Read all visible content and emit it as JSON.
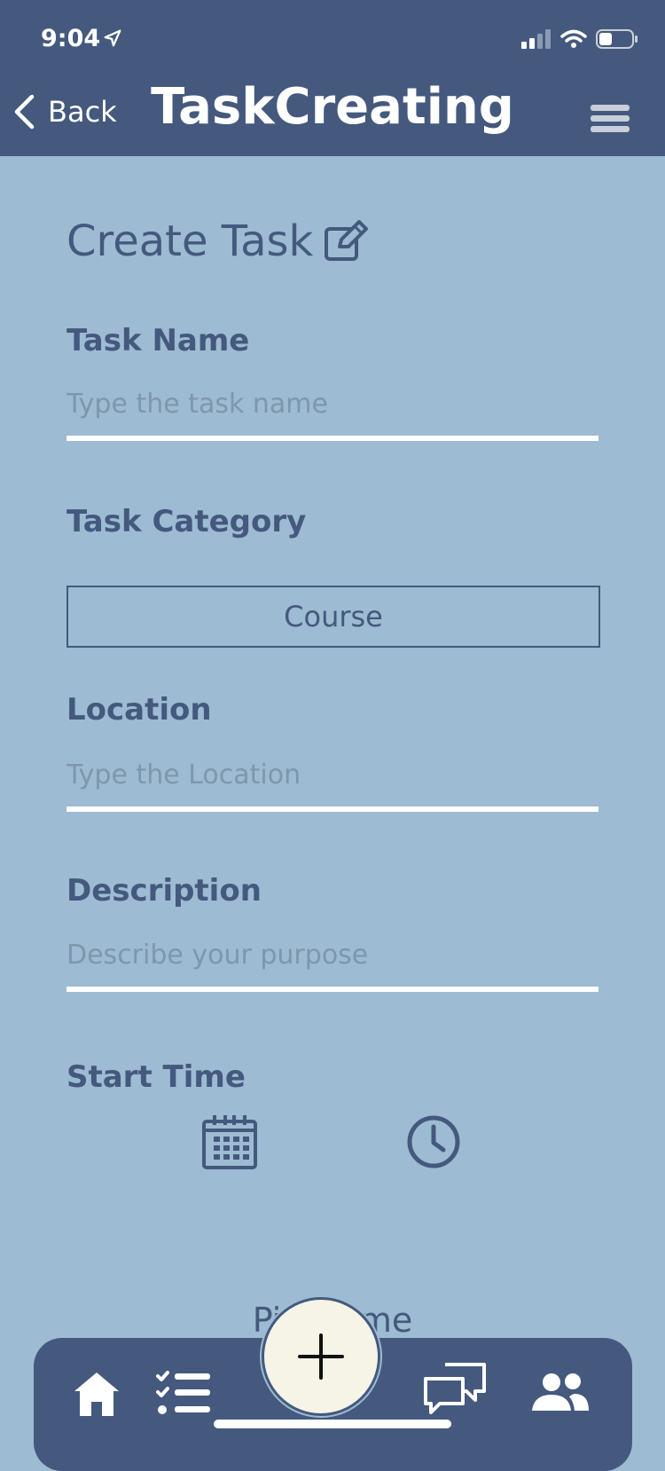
{
  "status_bar": {
    "time": "9:04"
  },
  "header": {
    "back_label": "Back",
    "title": "TaskCreating"
  },
  "form": {
    "heading": "Create Task",
    "task_name": {
      "label": "Task Name",
      "placeholder": "Type the task name"
    },
    "task_category": {
      "label": "Task Category",
      "value": "Course"
    },
    "location": {
      "label": "Location",
      "placeholder": "Type the Location"
    },
    "description": {
      "label": "Description",
      "placeholder": "Describe your purpose"
    },
    "start_time": {
      "label": "Start Time",
      "pick_time_label": "Pick Time"
    }
  },
  "bottom_nav": {
    "items": [
      "home-icon",
      "tasks-icon",
      "add-icon",
      "chat-icon",
      "people-icon"
    ]
  },
  "colors": {
    "header_bg": "#44597d",
    "page_bg": "#9dbbd2",
    "text": "#44597d",
    "fab_bg": "#f5f4e6"
  }
}
